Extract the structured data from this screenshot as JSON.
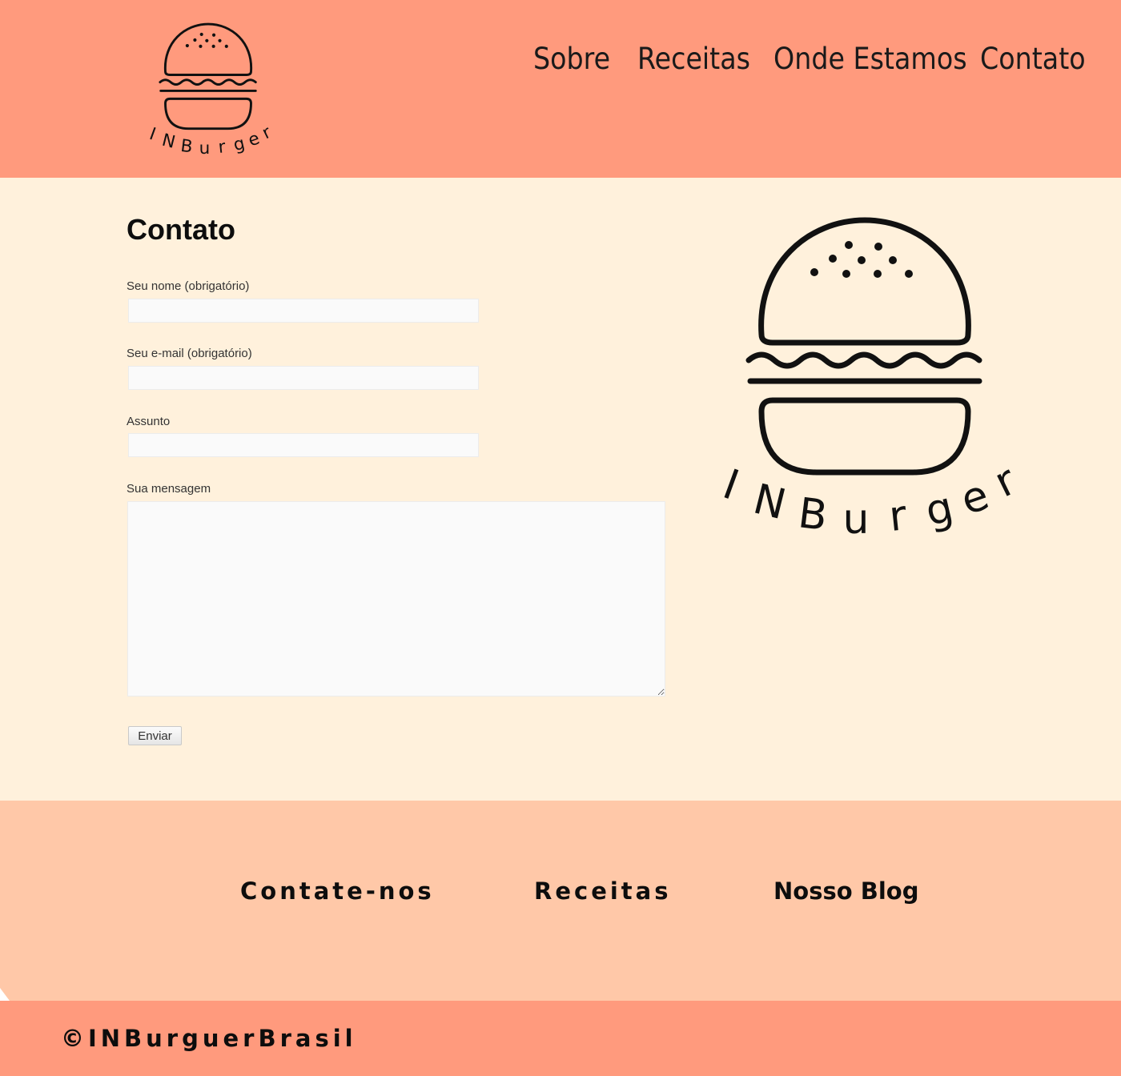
{
  "brand": {
    "logo_text": "INBurger",
    "logo_icon": "burger-icon"
  },
  "nav": {
    "items": [
      {
        "label": "Sobre"
      },
      {
        "label": "Receitas"
      },
      {
        "label": "Onde Estamos"
      },
      {
        "label": "Contato"
      }
    ]
  },
  "contact": {
    "title": "Contato",
    "name_label": "Seu nome (obrigatório)",
    "name_value": "",
    "email_label": "Seu e-mail (obrigatório)",
    "email_value": "",
    "subject_label": "Assunto",
    "subject_value": "",
    "message_label": "Sua mensagem",
    "message_value": "",
    "submit_label": "Enviar"
  },
  "footer": {
    "links": [
      {
        "label": "Contate-nos"
      },
      {
        "label": "Receitas"
      },
      {
        "label": "Nosso Blog"
      }
    ],
    "copyright": "©INBurguerBrasil"
  },
  "colors": {
    "header_bg": "#ff9a7d",
    "main_bg": "#fff1dc",
    "footer_bg": "#ffc8a8",
    "bottom_bg": "#ff9a7d"
  }
}
